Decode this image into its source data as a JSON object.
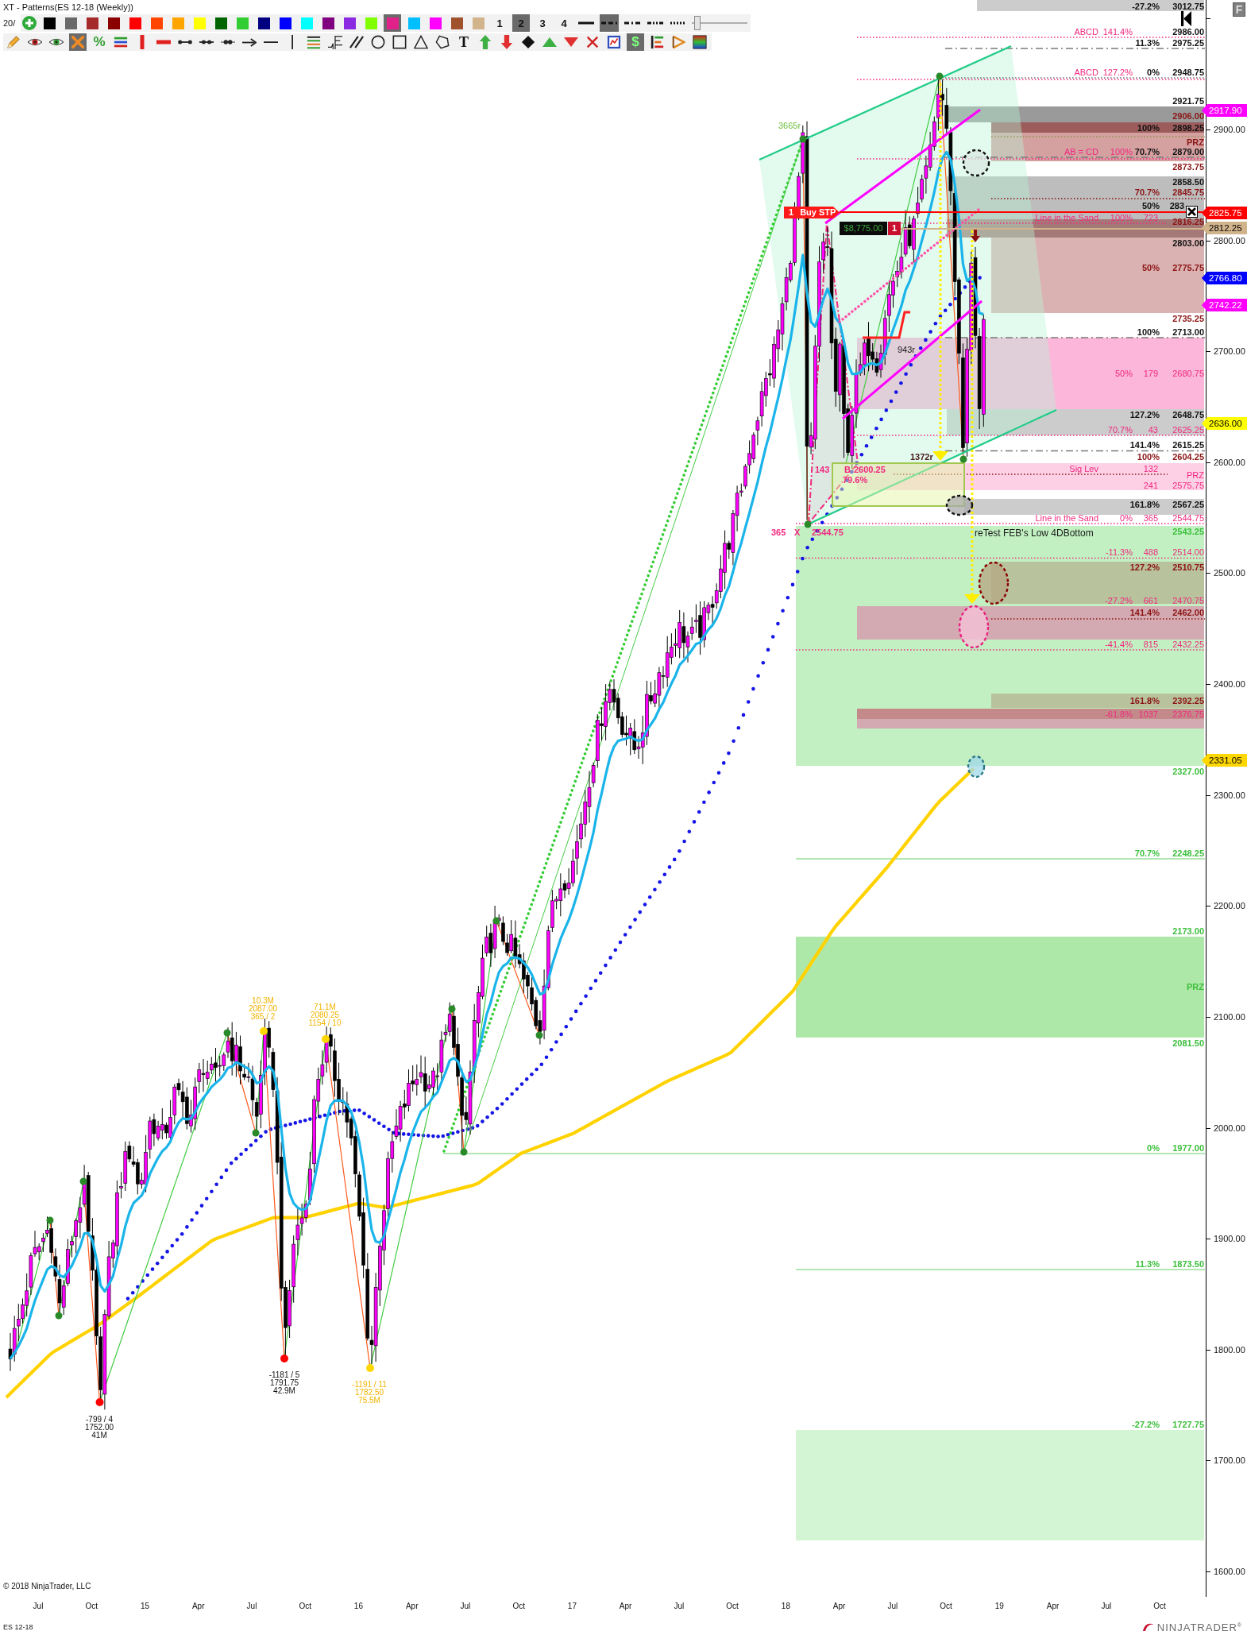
{
  "window": {
    "title": "XT - Patterns(ES 12-18 (Weekly))",
    "text_behind_toolbar": "20/"
  },
  "toolbar": {
    "colors": [
      {
        "color": "#000000",
        "selected": false
      },
      {
        "color": "#696969",
        "selected": false
      },
      {
        "color": "#a52a2a",
        "selected": false
      },
      {
        "color": "#8b0000",
        "selected": false
      },
      {
        "color": "#ff0000",
        "selected": false
      },
      {
        "color": "#ff4500",
        "selected": false
      },
      {
        "color": "#ffa500",
        "selected": false
      },
      {
        "color": "#ffff00",
        "selected": false
      },
      {
        "color": "#006400",
        "selected": false
      },
      {
        "color": "#32cd32",
        "selected": false
      },
      {
        "color": "#000080",
        "selected": false
      },
      {
        "color": "#0000ff",
        "selected": false
      },
      {
        "color": "#00ffff",
        "selected": false
      },
      {
        "color": "#800080",
        "selected": false
      },
      {
        "color": "#8a2be2",
        "selected": false
      },
      {
        "color": "#7fff00",
        "selected": false
      },
      {
        "color": "#e0218a",
        "selected": true
      },
      {
        "color": "#00bfff",
        "selected": false
      },
      {
        "color": "#ff00ff",
        "selected": false
      },
      {
        "color": "#a0522d",
        "selected": false
      },
      {
        "color": "#d2b48c",
        "selected": false
      }
    ],
    "widths": [
      {
        "label": "1",
        "selected": false
      },
      {
        "label": "2",
        "selected": true
      },
      {
        "label": "3",
        "selected": false
      },
      {
        "label": "4",
        "selected": false
      }
    ],
    "line_styles": [
      {
        "kind": "solid",
        "selected": false
      },
      {
        "kind": "dash",
        "selected": true
      },
      {
        "kind": "dashdot",
        "selected": false
      },
      {
        "kind": "dashdotdot",
        "selected": false
      },
      {
        "kind": "dot",
        "selected": false
      }
    ],
    "opacity_slider": {
      "level": 0.05
    },
    "tools": [
      {
        "kind": "pencil",
        "selected": false
      },
      {
        "kind": "hide",
        "selected": false
      },
      {
        "kind": "show",
        "selected": false
      },
      {
        "kind": "remove",
        "selected": true
      },
      {
        "kind": "percent",
        "label": "%",
        "selected": false
      },
      {
        "kind": "lines",
        "selected": false
      },
      {
        "kind": "vbar",
        "selected": false
      },
      {
        "kind": "hbar",
        "selected": false
      },
      {
        "kind": "segment",
        "selected": false
      },
      {
        "kind": "segment2",
        "selected": false
      },
      {
        "kind": "segment3",
        "selected": false
      },
      {
        "kind": "arrow",
        "selected": false
      },
      {
        "kind": "hline",
        "selected": false
      },
      {
        "kind": "vline",
        "selected": false
      },
      {
        "kind": "fib",
        "selected": false
      },
      {
        "kind": "fibtime",
        "selected": false
      },
      {
        "kind": "parallel",
        "selected": false
      },
      {
        "kind": "circle",
        "selected": false
      },
      {
        "kind": "square",
        "selected": false
      },
      {
        "kind": "triangle",
        "selected": false
      },
      {
        "kind": "polygon",
        "selected": false
      },
      {
        "kind": "text",
        "label": "T",
        "selected": false
      },
      {
        "kind": "uparrow",
        "selected": false
      },
      {
        "kind": "downarrow",
        "selected": false
      },
      {
        "kind": "diamond",
        "selected": false
      },
      {
        "kind": "uptriangle",
        "selected": false
      },
      {
        "kind": "downtriangle",
        "selected": false
      },
      {
        "kind": "delete",
        "selected": false
      },
      {
        "kind": "chart",
        "selected": false
      },
      {
        "kind": "dollar",
        "label": "$",
        "selected": true
      },
      {
        "kind": "ebars",
        "selected": false
      },
      {
        "kind": "path",
        "selected": false
      },
      {
        "kind": "gradient",
        "selected": false
      }
    ]
  },
  "chart": {
    "levels": [
      {
        "kind": "fib",
        "percent": "-27.2%",
        "price": "3012.75"
      },
      {
        "kind": "pattern",
        "name": "ABCD",
        "percent": "141.4%"
      },
      {
        "kind": "fib",
        "price": "2986.00"
      },
      {
        "kind": "fib",
        "percent": "11.3%",
        "price": "2975.25"
      },
      {
        "kind": "pattern",
        "name": "ABCD",
        "percent": "127.2%"
      },
      {
        "kind": "fib",
        "percent": "0%",
        "price": "2948.75"
      },
      {
        "kind": "fib",
        "price": "2921.75"
      },
      {
        "kind": "extension",
        "price": "2906.00"
      },
      {
        "kind": "fib",
        "percent": "100%",
        "price": "2898.25"
      },
      {
        "kind": "extension",
        "zone": "PRZ"
      },
      {
        "kind": "pattern",
        "name": "AB = CD",
        "percent": "100%"
      },
      {
        "kind": "fib",
        "percent": "70.7%",
        "price": "2879.00"
      },
      {
        "kind": "extension",
        "price": "2873.75"
      },
      {
        "kind": "fib",
        "price": "2858.50"
      },
      {
        "kind": "extension",
        "percent": "70.7%",
        "price": "2845.75"
      },
      {
        "kind": "fib",
        "percent": "50%",
        "price": "283"
      },
      {
        "kind": "pattern",
        "name": "Line in the Sand",
        "percent": "100%",
        "count": "723"
      },
      {
        "kind": "extension",
        "price": "2816.25"
      },
      {
        "kind": "fib",
        "price": "2803.00"
      },
      {
        "kind": "extension",
        "percent": "50%",
        "price": "2775.75"
      },
      {
        "kind": "extension",
        "price": "2735.25"
      },
      {
        "kind": "fib",
        "percent": "100%",
        "price": "2713.00"
      },
      {
        "kind": "pattern",
        "percent": "50%",
        "count": "179",
        "price": "2680.75"
      },
      {
        "kind": "fib",
        "percent": "127.2%",
        "price": "2648.75"
      },
      {
        "kind": "pattern",
        "percent": "70.7%",
        "count": "43",
        "price": "2625.25"
      },
      {
        "kind": "fib",
        "percent": "141.4%",
        "price": "2615.25"
      },
      {
        "kind": "extension",
        "percent": "100%",
        "price": "2604.25"
      },
      {
        "kind": "pattern",
        "name": "Sig Lev",
        "count": "132"
      },
      {
        "kind": "pattern",
        "zone": "PRZ"
      },
      {
        "kind": "pattern",
        "count": "241",
        "price": "2575.75"
      },
      {
        "kind": "fib",
        "percent": "161.8%",
        "price": "2567.25"
      },
      {
        "kind": "pattern",
        "name": "Line in the Sand",
        "percent": "0%",
        "count": "365",
        "price": "2544.75"
      },
      {
        "kind": "projection",
        "price": "2543.25"
      },
      {
        "kind": "pattern",
        "percent": "-11.3%",
        "count": "488",
        "price": "2514.00"
      },
      {
        "kind": "extension",
        "percent": "127.2%",
        "price": "2510.75"
      },
      {
        "kind": "pattern",
        "percent": "-27.2%",
        "count": "661",
        "price": "2470.75"
      },
      {
        "kind": "extension",
        "percent": "141.4%",
        "price": "2462.00"
      },
      {
        "kind": "pattern",
        "percent": "-41.4%",
        "count": "815",
        "price": "2432.25"
      },
      {
        "kind": "extension",
        "percent": "161.8%",
        "price": "2392.25"
      },
      {
        "kind": "pattern",
        "percent": "-61.8%",
        "count": "1037",
        "price": "2376.75"
      },
      {
        "kind": "projection",
        "price": "2327.00"
      },
      {
        "kind": "projection",
        "percent": "70.7%",
        "price": "2248.25"
      },
      {
        "kind": "projection",
        "price": "2173.00"
      },
      {
        "kind": "projection",
        "zone": "PRZ"
      },
      {
        "kind": "projection",
        "price": "2081.50"
      },
      {
        "kind": "projection",
        "percent": "0%",
        "price": "1977.00"
      },
      {
        "kind": "projection",
        "percent": "11.3%",
        "price": "1873.50"
      },
      {
        "kind": "projection",
        "percent": "-27.2%",
        "price": "1727.75"
      }
    ],
    "annotations": [
      {
        "text": "3665r",
        "color": "#6cbf3c"
      },
      {
        "text": "943r",
        "color": "#1a1a1a"
      },
      {
        "text": "1372r",
        "color": "#4a1a1a"
      },
      {
        "text": "143",
        "color": "#f0287f"
      },
      {
        "text": "B",
        "color": "#f0287f"
      },
      {
        "text": "2600.25",
        "color": "#f0287f"
      },
      {
        "text": "79.6%",
        "color": "#f0287f"
      },
      {
        "text": "365",
        "color": "#f0287f"
      },
      {
        "text": "X",
        "color": "#f0287f"
      },
      {
        "text": "2544.75",
        "color": "#f0287f"
      },
      {
        "text": "reTest FEB's Low 4DBottom",
        "color": "#1a1a1a"
      }
    ],
    "swing_labels": [
      {
        "kind": "tentative",
        "color": "#ffd700",
        "lines": [
          "10.3M",
          "2087.00",
          "365 / 2"
        ]
      },
      {
        "kind": "tentative",
        "color": "#ffd700",
        "lines": [
          "71.1M",
          "2080.25",
          "1154 / 10"
        ]
      },
      {
        "kind": "confirmed",
        "color": "#ff0000",
        "lines": [
          "-799 / 4",
          "1752.00",
          "41M"
        ]
      },
      {
        "kind": "confirmed",
        "color": "#ff0000",
        "lines": [
          "-1181 / 5",
          "1791.75",
          "42.9M"
        ]
      },
      {
        "kind": "tentative",
        "color": "#ffd700",
        "lines": [
          "-1191 / 11",
          "1782.50",
          "75.5M"
        ]
      }
    ],
    "order": {
      "quantity": "1",
      "label": "Buy STP"
    },
    "position": {
      "pnl": "$8,775.00",
      "quantity": "1"
    },
    "copyright": "© 2018 NinjaTrader, LLC"
  },
  "price_axis": {
    "ticks": [
      "2900.00",
      "2800.00",
      "2700.00",
      "2600.00",
      "2500.00",
      "2400.00",
      "2300.00",
      "2200.00",
      "2100.00",
      "2000.00",
      "1900.00",
      "1800.00",
      "1700.00",
      "1600.00"
    ],
    "tags": [
      {
        "text": "2917.90",
        "color": "#ff00ff"
      },
      {
        "text": "2825.75",
        "color": "#ff0000"
      },
      {
        "text": "2812.25",
        "color": "#d2b48c"
      },
      {
        "text": "2766.80",
        "color": "#0000ff"
      },
      {
        "text": "2742.22",
        "color": "#ff00ff"
      },
      {
        "text": "2636.00",
        "color": "#ffff00"
      },
      {
        "text": "2331.05",
        "color": "#ffd700"
      }
    ],
    "corner_button": "F"
  },
  "time_axis": {
    "labels": [
      "Jul",
      "Oct",
      "15",
      "Apr",
      "Jul",
      "Oct",
      "16",
      "Apr",
      "Jul",
      "Oct",
      "17",
      "Apr",
      "Jul",
      "Oct",
      "18",
      "Apr",
      "Jul",
      "Oct",
      "19",
      "Apr",
      "Jul",
      "Oct"
    ]
  },
  "footer": {
    "instrument": "ES 12-18",
    "brand": "NINJATRADER$^{®}$"
  }
}
